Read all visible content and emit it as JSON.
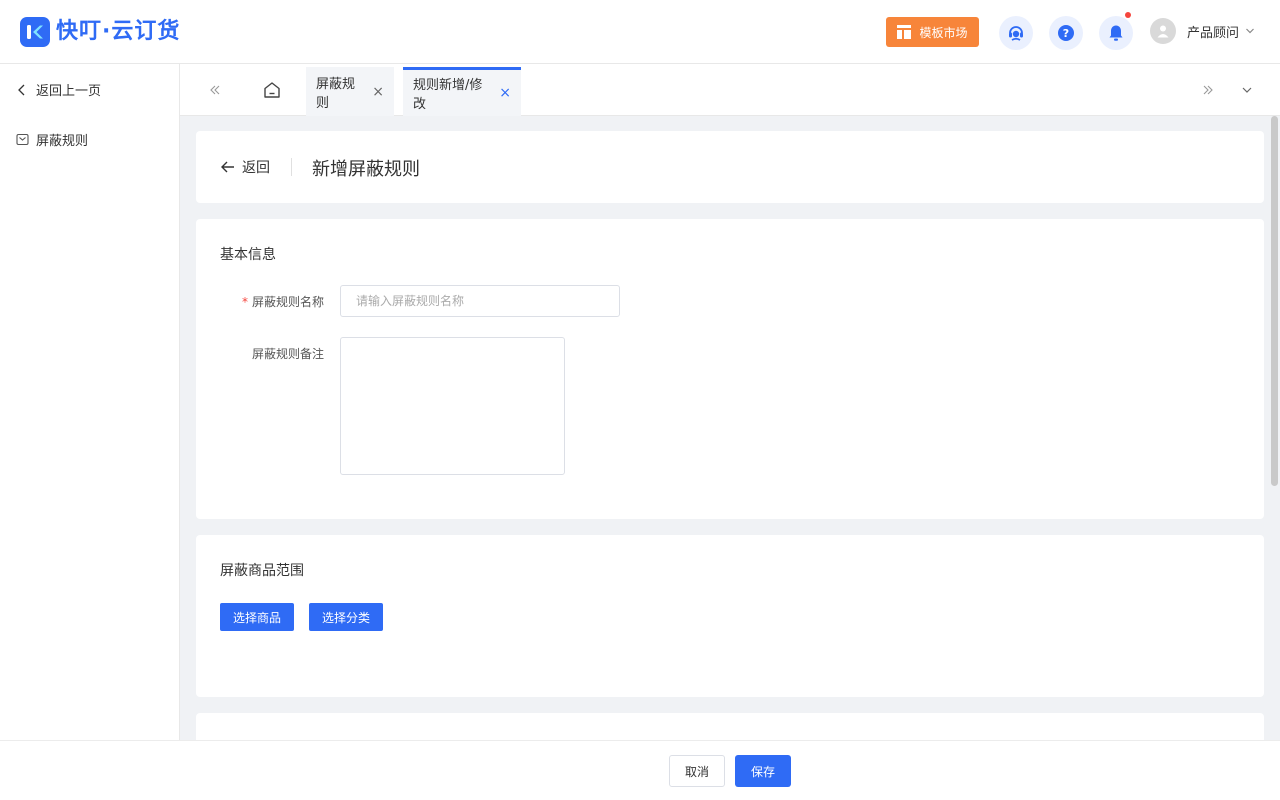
{
  "header": {
    "logo_text": "快叮·云订货",
    "market_label": "模板市场",
    "user_name": "产品顾问"
  },
  "sidebar": {
    "back_label": "返回上一页",
    "items": [
      {
        "label": "屏蔽规则"
      }
    ]
  },
  "tabs": [
    {
      "label": "屏蔽规则",
      "active": false
    },
    {
      "label": "规则新增/修改",
      "active": true
    }
  ],
  "page": {
    "back_label": "返回",
    "title": "新增屏蔽规则"
  },
  "basic_info": {
    "section_title": "基本信息",
    "name_label": "屏蔽规则名称",
    "name_required_mark": "*",
    "name_value": "",
    "name_placeholder": "请输入屏蔽规则名称",
    "note_label": "屏蔽规则备注",
    "note_value": ""
  },
  "scope": {
    "section_title": "屏蔽商品范围",
    "select_goods_label": "选择商品",
    "select_category_label": "选择分类"
  },
  "footer": {
    "cancel_label": "取消",
    "save_label": "保存"
  },
  "colors": {
    "primary": "#2f6bf5",
    "market": "#f7853a",
    "required": "#f5453d"
  }
}
